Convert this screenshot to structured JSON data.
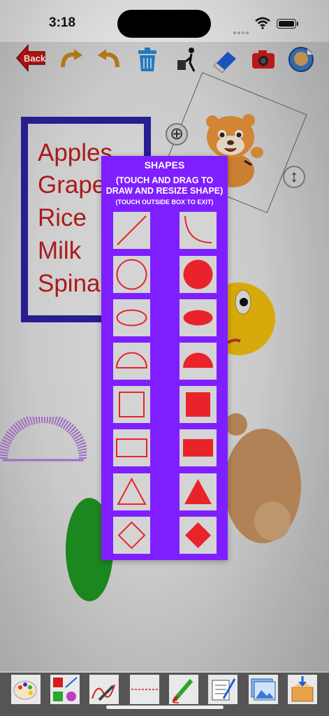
{
  "status_bar": {
    "time": "3:18"
  },
  "toolbar": {
    "back_label": "Back",
    "icons": [
      "redo-icon",
      "undo-icon",
      "trash-icon",
      "clear-all-icon",
      "eraser-icon",
      "camera-icon",
      "sticker-icon"
    ]
  },
  "canvas": {
    "list_items": [
      "Apples",
      "Grapes",
      "Rice",
      "Milk",
      "Spinach"
    ],
    "tiger_controls": {
      "remove_symbol": "⊕",
      "resize_symbol": "↕"
    }
  },
  "shapes_panel": {
    "title": "SHAPES",
    "instruction_line1": "(TOUCH AND DRAG TO",
    "instruction_line2": "DRAW AND RESIZE SHAPE)",
    "exit_hint": "(TOUCH OUTSIDE BOX TO EXIT)",
    "shapes": [
      [
        "line-outline",
        "curve-outline"
      ],
      [
        "circle-outline",
        "circle-filled"
      ],
      [
        "ellipse-outline",
        "ellipse-filled"
      ],
      [
        "semicircle-outline",
        "semicircle-filled"
      ],
      [
        "square-outline",
        "square-filled"
      ],
      [
        "rectangle-outline",
        "rectangle-filled"
      ],
      [
        "triangle-outline",
        "triangle-filled"
      ],
      [
        "diamond-outline",
        "diamond-filled"
      ]
    ],
    "shape_color": "#e8242a",
    "panel_color": "#7f1fff"
  },
  "bottom_toolbar": {
    "tools": [
      "paint-palette-icon",
      "shapes-tool-icon",
      "pencil-tool-icon",
      "dashed-line-icon",
      "marker-pen-icon",
      "text-tool-icon",
      "photo-library-icon",
      "save-box-icon"
    ]
  }
}
